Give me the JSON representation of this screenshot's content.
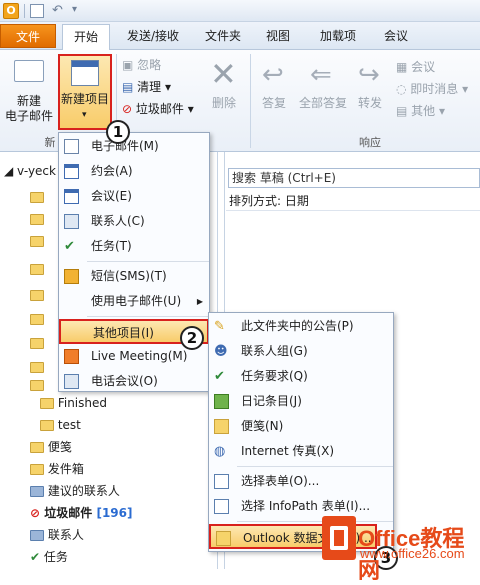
{
  "ribbon_tabs": [
    {
      "label": "文件"
    },
    {
      "label": "开始"
    },
    {
      "label": "发送/接收"
    },
    {
      "label": "文件夹"
    },
    {
      "label": "视图"
    },
    {
      "label": "加载项"
    },
    {
      "label": "会议"
    }
  ],
  "ribbon": {
    "new_email": "新建\n电子邮件",
    "new_items": "新建项目",
    "ignore": "忽略",
    "clean": "清理",
    "junk": "垃圾邮件",
    "delete": "删除",
    "reply": "答复",
    "reply_all": "全部答复",
    "forward": "转发",
    "meeting": "会议",
    "im": "即时消息",
    "more": "其他",
    "group_new": "新",
    "group_respond": "响应"
  },
  "nav": {
    "account": "v-yeck",
    "items": [
      {
        "label": "Finished"
      },
      {
        "label": "test"
      },
      {
        "label": "便笺"
      },
      {
        "label": "发件箱"
      },
      {
        "label": "建议的联系人"
      },
      {
        "label": "垃圾邮件",
        "count": "[196]"
      },
      {
        "label": "联系人"
      },
      {
        "label": "任务"
      }
    ]
  },
  "content": {
    "search_placeholder": "搜索 草稿 (Ctrl+E)",
    "sort_label": "排列方式: 日期"
  },
  "menu1": [
    {
      "label": "电子邮件(M)"
    },
    {
      "label": "约会(A)"
    },
    {
      "label": "会议(E)"
    },
    {
      "label": "联系人(C)"
    },
    {
      "label": "任务(T)"
    },
    {
      "label": "短信(SMS)(T)"
    },
    {
      "label": "使用电子邮件(U)"
    },
    {
      "label": "其他项目(I)"
    },
    {
      "label": "Live Meeting(M)"
    },
    {
      "label": "电话会议(O)"
    }
  ],
  "menu2": [
    {
      "label": "此文件夹中的公告(P)"
    },
    {
      "label": "联系人组(G)"
    },
    {
      "label": "任务要求(Q)"
    },
    {
      "label": "日记条目(J)"
    },
    {
      "label": "便笺(N)"
    },
    {
      "label": "Internet 传真(X)"
    },
    {
      "label": "选择表单(O)..."
    },
    {
      "label": "选择 InfoPath 表单(I)..."
    },
    {
      "label": "Outlook 数据文件(D)..."
    }
  ],
  "callouts": [
    "1",
    "2",
    "3"
  ],
  "watermark": {
    "brand": "Office教程网",
    "url": "www.office26.com"
  },
  "colors": {
    "file_tab": "#e06b00",
    "highlight": "#f8cc6a",
    "callout_box": "#d8211d"
  }
}
